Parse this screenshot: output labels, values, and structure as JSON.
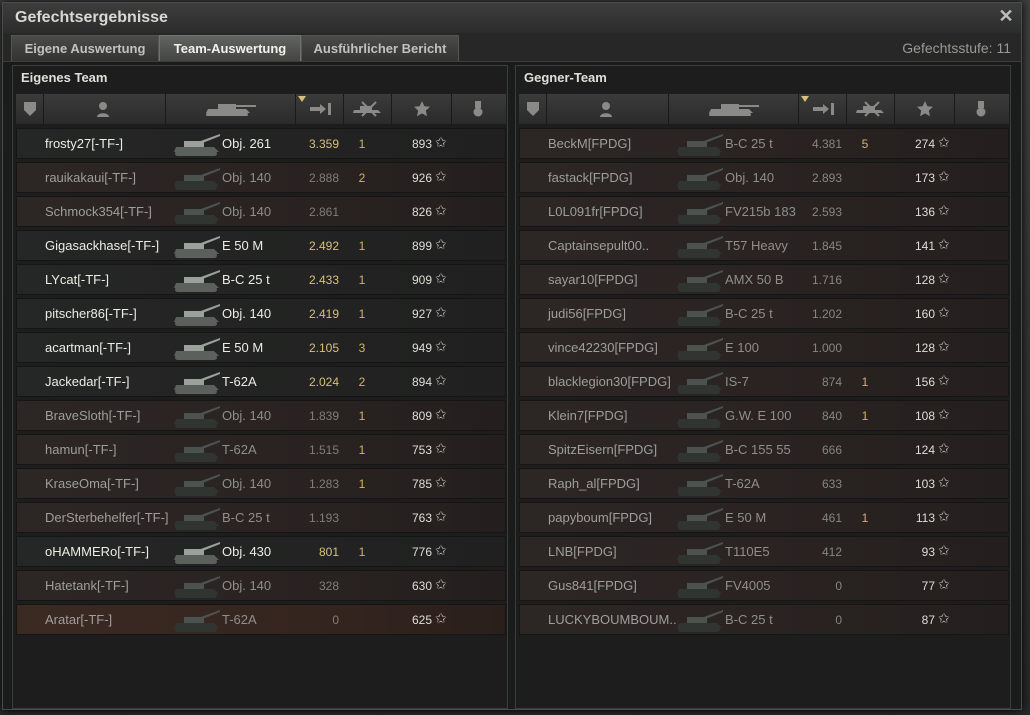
{
  "window": {
    "title": "Gefechtsergebnisse",
    "close_icon": "close-icon"
  },
  "tabs": [
    {
      "label": "Eigene Auswertung",
      "active": false
    },
    {
      "label": "Team-Auswertung",
      "active": true
    },
    {
      "label": "Ausführlicher Bericht",
      "active": false
    }
  ],
  "tier_text": "Gefechtsstufe: 11",
  "own_team": {
    "title": "Eigenes Team",
    "rows": [
      {
        "name": "frosty27[-TF-]",
        "tank": "Obj. 261",
        "damage": "3.359",
        "kills": "1",
        "xp": "893",
        "alive": true
      },
      {
        "name": "rauikakaui[-TF-]",
        "tank": "Obj. 140",
        "damage": "2.888",
        "kills": "2",
        "xp": "926",
        "alive": false
      },
      {
        "name": "Schmock354[-TF-]",
        "tank": "Obj. 140",
        "damage": "2.861",
        "kills": "",
        "xp": "826",
        "alive": false
      },
      {
        "name": "Gigasackhase[-TF-]",
        "tank": "E 50 M",
        "damage": "2.492",
        "kills": "1",
        "xp": "899",
        "alive": true
      },
      {
        "name": "LYcat[-TF-]",
        "tank": "B-C 25 t",
        "damage": "2.433",
        "kills": "1",
        "xp": "909",
        "alive": true
      },
      {
        "name": "pitscher86[-TF-]",
        "tank": "Obj. 140",
        "damage": "2.419",
        "kills": "1",
        "xp": "927",
        "alive": true
      },
      {
        "name": "acartman[-TF-]",
        "tank": "E 50 M",
        "damage": "2.105",
        "kills": "3",
        "xp": "949",
        "alive": true
      },
      {
        "name": "Jackedar[-TF-]",
        "tank": "T-62A",
        "damage": "2.024",
        "kills": "2",
        "xp": "894",
        "alive": true
      },
      {
        "name": "BraveSloth[-TF-]",
        "tank": "Obj. 140",
        "damage": "1.839",
        "kills": "1",
        "xp": "809",
        "alive": false
      },
      {
        "name": "hamun[-TF-]",
        "tank": "T-62A",
        "damage": "1.515",
        "kills": "1",
        "xp": "753",
        "alive": false
      },
      {
        "name": "KraseOma[-TF-]",
        "tank": "Obj. 140",
        "damage": "1.283",
        "kills": "1",
        "xp": "785",
        "alive": false
      },
      {
        "name": "DerSterbehelfer[-TF-]",
        "tank": "B-C 25 t",
        "damage": "1.193",
        "kills": "",
        "xp": "763",
        "alive": false
      },
      {
        "name": "oHAMMERo[-TF-]",
        "tank": "Obj. 430",
        "damage": "801",
        "kills": "1",
        "xp": "776",
        "alive": true
      },
      {
        "name": "Hatetank[-TF-]",
        "tank": "Obj. 140",
        "damage": "328",
        "kills": "",
        "xp": "630",
        "alive": false
      },
      {
        "name": "Aratar[-TF-]",
        "tank": "T-62A",
        "damage": "0",
        "kills": "",
        "xp": "625",
        "alive": false,
        "highlight": true
      }
    ]
  },
  "enemy_team": {
    "title": "Gegner-Team",
    "rows": [
      {
        "name": "BeckM[FPDG]",
        "tank": "B-C 25 t",
        "damage": "4.381",
        "kills": "5",
        "xp": "274"
      },
      {
        "name": "fastack[FPDG]",
        "tank": "Obj. 140",
        "damage": "2.893",
        "kills": "",
        "xp": "173"
      },
      {
        "name": "L0L091fr[FPDG]",
        "tank": "FV215b 183",
        "damage": "2.593",
        "kills": "",
        "xp": "136"
      },
      {
        "name": "Captainsepult00..",
        "tank": "T57 Heavy",
        "damage": "1.845",
        "kills": "",
        "xp": "141"
      },
      {
        "name": "sayar10[FPDG]",
        "tank": "AMX 50 B",
        "damage": "1.716",
        "kills": "",
        "xp": "128"
      },
      {
        "name": "judi56[FPDG]",
        "tank": "B-C 25 t",
        "damage": "1.202",
        "kills": "",
        "xp": "160"
      },
      {
        "name": "vince42230[FPDG]",
        "tank": "E 100",
        "damage": "1.000",
        "kills": "",
        "xp": "128"
      },
      {
        "name": "blacklegion30[FPDG]",
        "tank": "IS-7",
        "damage": "874",
        "kills": "1",
        "xp": "156"
      },
      {
        "name": "Klein7[FPDG]",
        "tank": "G.W. E 100",
        "damage": "840",
        "kills": "1",
        "xp": "108"
      },
      {
        "name": "SpitzEisern[FPDG]",
        "tank": "B-C 155 55",
        "damage": "666",
        "kills": "",
        "xp": "124"
      },
      {
        "name": "Raph_al[FPDG]",
        "tank": "T-62A",
        "damage": "633",
        "kills": "",
        "xp": "103"
      },
      {
        "name": "papyboum[FPDG]",
        "tank": "E 50 M",
        "damage": "461",
        "kills": "1",
        "xp": "113"
      },
      {
        "name": "LNB[FPDG]",
        "tank": "T110E5",
        "damage": "412",
        "kills": "",
        "xp": "93"
      },
      {
        "name": "Gus841[FPDG]",
        "tank": "FV4005",
        "damage": "0",
        "kills": "",
        "xp": "77"
      },
      {
        "name": "LUCKYBOUMBOUM..",
        "tank": "B-C 25 t",
        "damage": "0",
        "kills": "",
        "xp": "87"
      }
    ]
  }
}
